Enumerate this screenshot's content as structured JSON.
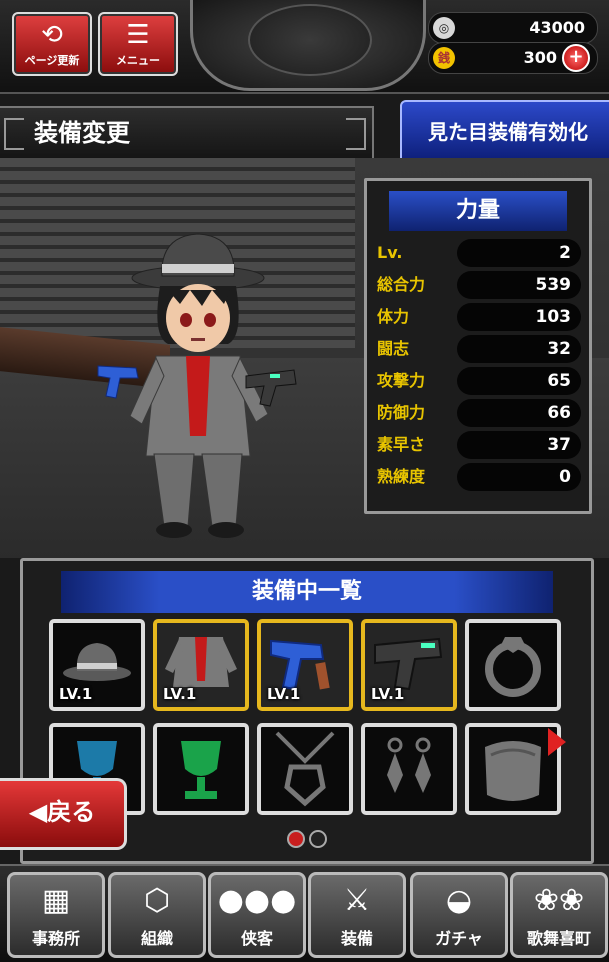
{
  "top": {
    "refresh_label": "ページ更新",
    "menu_label": "メニュー",
    "currency1_value": "43000",
    "currency2_value": "300",
    "currency2_icon_char": "銭"
  },
  "header": {
    "title": "装備変更",
    "appearance_button": "見た目装備有効化"
  },
  "stats": {
    "heading": "力量",
    "rows": [
      {
        "label": "Lv.",
        "value": "2"
      },
      {
        "label": "総合力",
        "value": "539"
      },
      {
        "label": "体力",
        "value": "103"
      },
      {
        "label": "闘志",
        "value": "32"
      },
      {
        "label": "攻撃力",
        "value": "65"
      },
      {
        "label": "防御力",
        "value": "66"
      },
      {
        "label": "素早さ",
        "value": "37"
      },
      {
        "label": "熟練度",
        "value": "0"
      }
    ]
  },
  "equip": {
    "heading": "装備中一覧",
    "slots": [
      {
        "icon": "fedora-hat-icon",
        "level": "LV.1"
      },
      {
        "icon": "red-suit-icon",
        "level": "LV.1"
      },
      {
        "icon": "blue-revolver-icon",
        "level": "LV.1"
      },
      {
        "icon": "black-pistol-icon",
        "level": "LV.1"
      },
      {
        "icon": "ring-icon",
        "level": ""
      },
      {
        "icon": "blue-trophy-icon",
        "level": ""
      },
      {
        "icon": "green-trophy-icon",
        "level": ""
      },
      {
        "icon": "necklace-icon",
        "level": ""
      },
      {
        "icon": "earrings-icon",
        "level": ""
      },
      {
        "icon": "bracelet-icon",
        "level": ""
      }
    ],
    "page_indicator": {
      "current": 1,
      "total": 2
    }
  },
  "back_label": "◀戻る",
  "nav": [
    {
      "label": "事務所",
      "icon": "office-icon"
    },
    {
      "label": "組織",
      "icon": "organization-icon"
    },
    {
      "label": "侠客",
      "icon": "members-icon"
    },
    {
      "label": "装備",
      "icon": "crossed-swords-icon"
    },
    {
      "label": "ガチャ",
      "icon": "gacha-bowl-icon"
    },
    {
      "label": "歌舞喜町",
      "icon": "town-crest-icon"
    }
  ],
  "colors": {
    "accent_red": "#c81e1e",
    "header_blue": "#1f3aa8",
    "stat_label_yellow": "#e8c400",
    "equipped_gold": "#e6b81e"
  }
}
